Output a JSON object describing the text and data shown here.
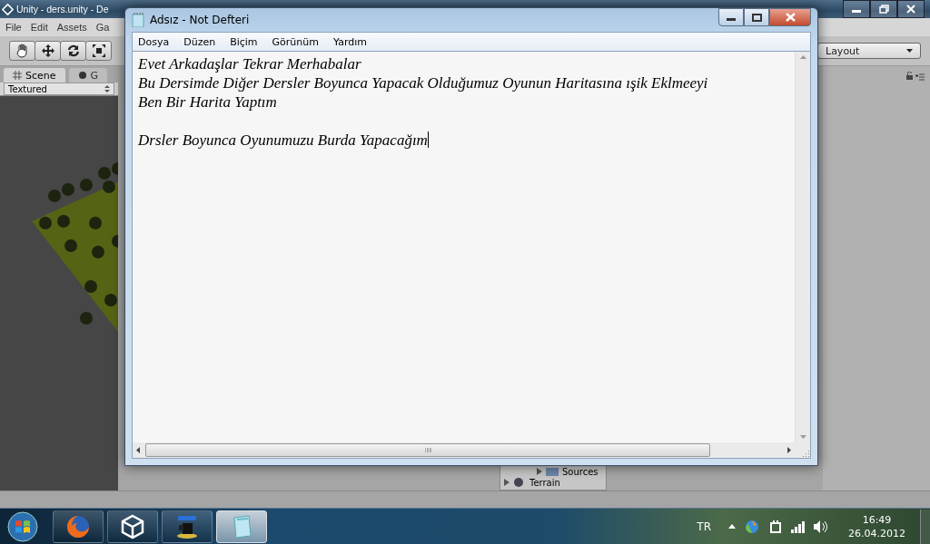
{
  "unity_window": {
    "title": "Unity - ders.unity - De",
    "menu": [
      "File",
      "Edit",
      "Assets",
      "Ga"
    ],
    "scene_tabs": [
      {
        "label": "Scene",
        "selected": true
      },
      {
        "label": "G",
        "selected": false
      }
    ],
    "shading_mode": "Textured",
    "layout_dropdown": "Layout",
    "hierarchy_items": [
      "Sources",
      "Terrain"
    ]
  },
  "notepad": {
    "title": "Adsız - Not Defteri",
    "menu": [
      "Dosya",
      "Düzen",
      "Biçim",
      "Görünüm",
      "Yardım"
    ],
    "paragraphs": [
      [
        "Evet Arkadaşlar Tekrar Merhabalar",
        "Bu Dersimde Diğer Dersler Boyunca Yapacak Olduğumuz Oyunun Haritasına ışik Eklmeeyi",
        "Ben Bir Harita Yaptım"
      ],
      [
        "Drsler Boyunca Oyunumuzu Burda Yapacağım"
      ]
    ]
  },
  "taskbar": {
    "apps": [
      {
        "kind": "browser",
        "selected": false
      },
      {
        "kind": "unity",
        "selected": false
      },
      {
        "kind": "camera",
        "selected": false
      },
      {
        "kind": "notepad",
        "selected": true
      }
    ],
    "language": "TR",
    "time": "16:49",
    "date": "26.04.2012"
  }
}
